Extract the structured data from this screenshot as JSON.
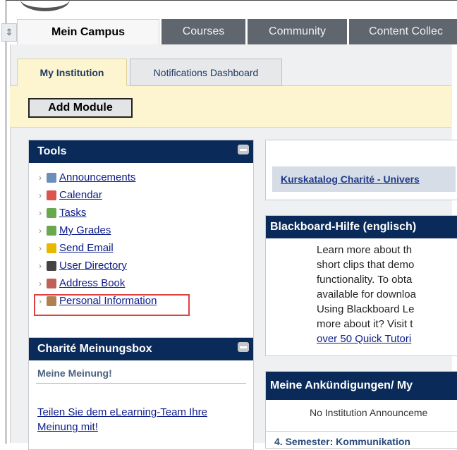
{
  "tabs": [
    {
      "label": "Mein Campus",
      "active": true
    },
    {
      "label": "Courses",
      "active": false
    },
    {
      "label": "Community",
      "active": false
    },
    {
      "label": "Content Collec",
      "active": false
    }
  ],
  "subtabs": [
    {
      "label": "My Institution",
      "active": true
    },
    {
      "label": "Notifications Dashboard",
      "active": false
    }
  ],
  "add_module_label": "Add Module",
  "tools": {
    "title": "Tools",
    "items": [
      {
        "label": "Announcements",
        "icon": "announcements-icon",
        "color": "#6b8fb8"
      },
      {
        "label": "Calendar",
        "icon": "calendar-icon",
        "color": "#d9534f"
      },
      {
        "label": "Tasks",
        "icon": "tasks-icon",
        "color": "#6aa84f"
      },
      {
        "label": "My Grades",
        "icon": "grades-icon",
        "color": "#6aa84f"
      },
      {
        "label": "Send Email",
        "icon": "email-icon",
        "color": "#e6b800"
      },
      {
        "label": "User Directory",
        "icon": "user-directory-icon",
        "color": "#444444"
      },
      {
        "label": "Address Book",
        "icon": "address-book-icon",
        "color": "#c0605a"
      },
      {
        "label": "Personal Information",
        "icon": "personal-info-icon",
        "color": "#b08050"
      }
    ]
  },
  "meinungsbox": {
    "title": "Charité Meinungsbox",
    "subtitle": "Meine Meinung!",
    "link_line1": "Teilen Sie dem eLearning-Team Ihre",
    "link_line2": "Meinung mit!"
  },
  "kurskatalog": {
    "label": "Kurskatalog Charité - Univers"
  },
  "help": {
    "title": "Blackboard-Hilfe (englisch)",
    "lines": [
      "Learn more about th",
      "short clips that demo",
      "functionality. To obta",
      "available for downloa",
      "Using Blackboard Le",
      "more about it? Visit t"
    ],
    "link": "over 50 Quick Tutori"
  },
  "announcements": {
    "title": "Meine Ankündigungen/ My",
    "empty": "No Institution Announceme",
    "semester": "4. Semester: Kommunikation"
  },
  "colors": {
    "header_navy": "#0a2a5a",
    "tab_gray": "#5f666e",
    "subbar_yellow": "#fdf5cf",
    "highlight_red": "#e04040"
  }
}
